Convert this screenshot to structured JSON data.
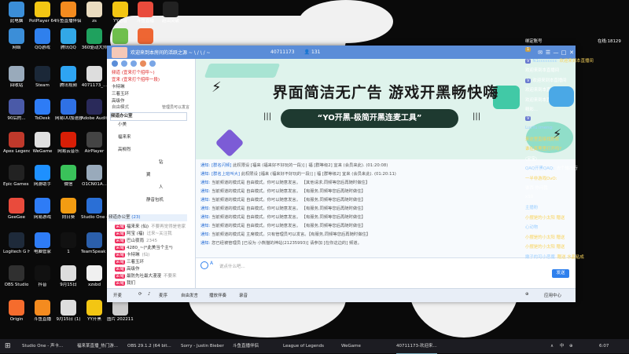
{
  "desktop_icons": [
    {
      "label": "此电脑",
      "color": "#3b8ed8"
    },
    {
      "label": "PotPlayer 64 bit",
      "color": "#f3c613"
    },
    {
      "label": "斗鱼直播伴侣",
      "color": "#f48b1f"
    },
    {
      "label": "zs",
      "color": "#eadcc0"
    },
    {
      "label": "YY语音",
      "color": "#f3c613"
    },
    {
      "label": "斗鱼直播",
      "color": "#e94b3c"
    },
    {
      "label": "超出突破",
      "color": "#222"
    },
    {
      "label": "网络",
      "color": "#3b8ed8"
    },
    {
      "label": "QQ游戏",
      "color": "#2f80ed"
    },
    {
      "label": "腾讯QQ",
      "color": "#32a8e7"
    },
    {
      "label": "360驱动大师",
      "color": "#1fa15e"
    },
    {
      "label": "Peacelit",
      "color": "#6fbf4d"
    },
    {
      "label": "腾讯网游加速器",
      "color": "#e63"
    },
    {
      "label": "回收站",
      "color": "#9ab"
    },
    {
      "label": "Steam",
      "color": "#1b2838"
    },
    {
      "label": "腾讯视频",
      "color": "#2ea4f2"
    },
    {
      "label": "4071173_...",
      "color": "#ddd"
    },
    {
      "label": "90后的...",
      "color": "#4a5aa8"
    },
    {
      "label": "ToDesk",
      "color": "#2e7cf6"
    },
    {
      "label": "网易UU加速器",
      "color": "#2f71e5"
    },
    {
      "label": "Adobe Audit...",
      "color": "#2a2a5a"
    },
    {
      "label": "Apex Legends",
      "color": "#c0392b"
    },
    {
      "label": "WeGame",
      "color": "#e0e0e0"
    },
    {
      "label": "网易云音乐",
      "color": "#d81e06"
    },
    {
      "label": "AirPlayer",
      "color": "#444"
    },
    {
      "label": "Epic Games Launcher",
      "color": "#222"
    },
    {
      "label": "网游助手",
      "color": "#1e90ff"
    },
    {
      "label": "微信",
      "color": "#3ac25a"
    },
    {
      "label": "O1CN01A...",
      "color": "#9ab"
    },
    {
      "label": "GeeGee",
      "color": "#e94b3c"
    },
    {
      "label": "网易游戏",
      "color": "#2e7cf6"
    },
    {
      "label": "向日葵",
      "color": "#f39c12"
    },
    {
      "label": "Studio One 4",
      "color": "#2a6fd6"
    },
    {
      "label": "Logitech G HUB",
      "color": "#1e2a3a"
    },
    {
      "label": "电脑管家",
      "color": "#2e7cf6"
    },
    {
      "label": "1",
      "color": "#111"
    },
    {
      "label": "TeamSpeak 3 Client",
      "color": "#2b5fab"
    },
    {
      "label": "OBS Studio",
      "color": "#303030"
    },
    {
      "label": "抖音",
      "color": "#111"
    },
    {
      "label": "9月15日",
      "color": "#ddd"
    },
    {
      "label": "xzsbd",
      "color": "#f0f0f0"
    },
    {
      "label": "Origin",
      "color": "#f56c2d"
    },
    {
      "label": "斗鱼直播",
      "color": "#f48b1f"
    },
    {
      "label": "9月15日 (1)",
      "color": "#ddd"
    },
    {
      "label": "YY开黑",
      "color": "#f3c613"
    },
    {
      "label": "图片 20221112...",
      "color": "#ccc"
    }
  ],
  "window": {
    "title": "欢迎来到本房间的活跃之源 ~ \\ / \\ / ~",
    "room_id": "40711173",
    "member_count": "131",
    "controls": [
      "✉",
      "☰",
      "—",
      "□",
      "✕"
    ]
  },
  "sidebar": {
    "rows": [
      {
        "text": "频道 (宜来打个招呼~)",
        "color": "red"
      },
      {
        "text": "宜来 (宜来打个招呼一段)",
        "color": "red"
      },
      {
        "text": "卡特琳",
        "color": "normal"
      },
      {
        "text": "三着玉环",
        "color": "normal"
      },
      {
        "text": "高级作",
        "color": "normal"
      }
    ],
    "mode_label": "自由模式",
    "admin_label": "管理员可以发言",
    "channel_root": "频道办公室",
    "channel_items": [
      "小美",
      "福来来",
      "高柳烈",
      "钻",
      "翼",
      "人",
      "静音包机"
    ],
    "sub_channel": "频道办公室",
    "sub_count": "(23)",
    "members": [
      {
        "level": "荣耀",
        "name": "福来来 (仙)",
        "badge": "不要再觉得是他家"
      },
      {
        "level": "荣耀",
        "name": "阿宝 (福)",
        "badge": "过来~关注我"
      },
      {
        "level": "荣耀",
        "name": "巴山夜雨",
        "badge": "2345"
      },
      {
        "level": "荣耀",
        "name": "4280_~(*此美当个主*)",
        "badge": ""
      },
      {
        "level": "荣耀",
        "name": "卡特琳",
        "badge": "(仙)"
      },
      {
        "level": "荣耀",
        "name": "三着玉环",
        "badge": ""
      },
      {
        "level": "荣耀",
        "name": "高级作",
        "badge": ""
      },
      {
        "level": "荣耀",
        "name": "最防先吐最大漫漫",
        "badge": "不要来"
      },
      {
        "level": "荣耀",
        "name": "我们",
        "badge": ""
      }
    ]
  },
  "banner": {
    "title": "界面简洁无广告  游戏开黑畅快嗨",
    "slogan": "“YO开黑-极简开黑连麦工具”"
  },
  "chat": {
    "messages": [
      {
        "prefix": "通知:",
        "tag": "[群名闪频]",
        "text": "此权限设 [福来 (福来好不好玩的一段)]  | 福 [群等级2] 宜来 (会员来此). (01:20:08)"
      },
      {
        "prefix": "通知:",
        "tag": "[群名上班叫大]",
        "text": "此权限设 [福来 (福来好不好玩的一段)]  | 福 [群等级2] 宜来 (会员来此). (01:20:11)"
      },
      {
        "prefix": "通知:",
        "tag": "",
        "text": "当前频道的模式是 自由模式。你可以随意发言。 【其他请求,同频等您后再随时做住】"
      },
      {
        "prefix": "通知:",
        "tag": "",
        "text": "当前频道的模式是 自由模式。你可以随意发言。 【有服务,同频等您后再随时做住】"
      },
      {
        "prefix": "通知:",
        "tag": "",
        "text": "当前频道的模式是 自由模式。你可以随意发言。 【有服务,同频等您后再随时做住】"
      },
      {
        "prefix": "通知:",
        "tag": "",
        "text": "当前频道的模式是 自由模式。你可以随意发言。 【有服务,同频等您后再随时做住】"
      },
      {
        "prefix": "通知:",
        "tag": "",
        "text": "当前频道的模式是 自由模式。你可以随意发言。 【有服务,同频等您后再随时做住】"
      },
      {
        "prefix": "通知:",
        "tag": "",
        "text": "当前频道的模式是 自由模式。你可以随意发言。 【有服务,同频等您后再随时做住】"
      },
      {
        "prefix": "通知:",
        "tag": "",
        "text": "当前频道的模式是 主席模式。只有管理员可以发言。【有服务,同频等您后再随时做住】"
      },
      {
        "prefix": "通知:",
        "tag": "",
        "text": "您已经被管理员 [已设为 小熊猫的神站(21235993)] 请参加 [在你这边的] 频道。"
      }
    ],
    "input_placeholder": "说点什么吧...",
    "send_label": "发送"
  },
  "bottombar": {
    "items": [
      "开麦",
      "⟳",
      "♪",
      "麦序",
      "自由发言",
      "播放伴奏",
      "录音"
    ],
    "right": [
      "⊕",
      "应用中心"
    ]
  },
  "right_chat": {
    "header_left": "绑定账号",
    "header_right": "在线:18129",
    "rows": [
      {
        "badge": "1",
        "badge_color": "#c7a04b",
        "user": "",
        "text": "",
        "color": "#fff"
      },
      {
        "badge": "V",
        "badge_color": "#6a7bd0",
        "user": "N1cccccccc",
        "text": "欢迎来到本直播间",
        "color": "#f8d35b"
      },
      {
        "badge": "",
        "badge_color": "#888",
        "user": "",
        "text": "欢迎来到本直播间",
        "color": "#fff"
      },
      {
        "badge": "V",
        "badge_color": "#6a7bd0",
        "user": "",
        "text": "欢迎来到本直播间",
        "color": "#fff"
      },
      {
        "badge": "",
        "badge_color": "#888",
        "user": "",
        "text": "欢迎来到本直播间",
        "color": "#fff"
      },
      {
        "badge": "",
        "badge_color": "#888",
        "user": "",
        "text": "欢迎来到本直播间",
        "color": "#fff"
      },
      {
        "badge": "",
        "badge_color": "#888",
        "user": "",
        "text": "精彩...",
        "color": "#fff"
      },
      {
        "badge": "V",
        "badge_color": "#6a7bd0",
        "user": "",
        "text": "",
        "color": "#fff"
      },
      {
        "badge": "",
        "badge_color": "#888",
        "user": "LucYu lmeng:",
        "text": "",
        "color": "#f8d35b"
      },
      {
        "badge": "",
        "badge_color": "#888",
        "user": "",
        "text": "来这里直接找好转",
        "color": "#f8d35b"
      },
      {
        "badge": "",
        "badge_color": "#888",
        "user": "",
        "text": "谁在真黑里打开吗?",
        "color": "#f8d35b"
      },
      {
        "badge": "",
        "badge_color": "#888",
        "user": "",
        "text": "(宝宝)",
        "color": "#fff"
      },
      {
        "badge": "",
        "badge_color": "#888",
        "user": "QAQ开黑QAQ:",
        "text": "去个输出行",
        "color": "#fff"
      },
      {
        "badge": "",
        "badge_color": "#888",
        "user": "",
        "text": "一半非游戏OvO:",
        "color": "#f8d35b"
      },
      {
        "badge": "",
        "badge_color": "#888",
        "user": "",
        "text": "谁西 你问我",
        "color": "#fff"
      },
      {
        "badge": "",
        "badge_color": "#888",
        "user": "",
        "text": "x10",
        "color": "#fff"
      },
      {
        "badge": "",
        "badge_color": "#888",
        "user": "主播粉",
        "text": "",
        "color": "#f8d35b"
      },
      {
        "badge": "",
        "badge_color": "#888",
        "user": "",
        "text": "小摆是的小太阳 赠送",
        "color": "#f8d35b"
      },
      {
        "badge": "",
        "badge_color": "#888",
        "user": "心动物",
        "text": "",
        "color": "#f8d35b"
      },
      {
        "badge": "",
        "badge_color": "#888",
        "user": "",
        "text": "小摆是的小太阳 赠送",
        "color": "#f8d35b"
      },
      {
        "badge": "",
        "badge_color": "#888",
        "user": "",
        "text": "小摆是的小太阳 赠送",
        "color": "#f8d35b"
      },
      {
        "badge": "",
        "badge_color": "#888",
        "user": "嫩子的可小恶魔",
        "text": "赠送 水晶粘成",
        "color": "#f8d35b"
      }
    ]
  },
  "taskbar": {
    "items": [
      {
        "label": "Studio One - 声卡..."
      },
      {
        "label": "福来某直播_热门游..."
      },
      {
        "label": "OBS 29.1.2 (64 bit..."
      },
      {
        "label": "Sorry - Justin Bieber"
      },
      {
        "label": "斗鱼直播伴侣"
      },
      {
        "label": "League of Legends"
      },
      {
        "label": "WeGame"
      },
      {
        "label": "40711173-欢迎来..."
      }
    ],
    "tray": [
      "∧",
      "中",
      "⊕",
      "6:07"
    ],
    "time": "6:07"
  }
}
